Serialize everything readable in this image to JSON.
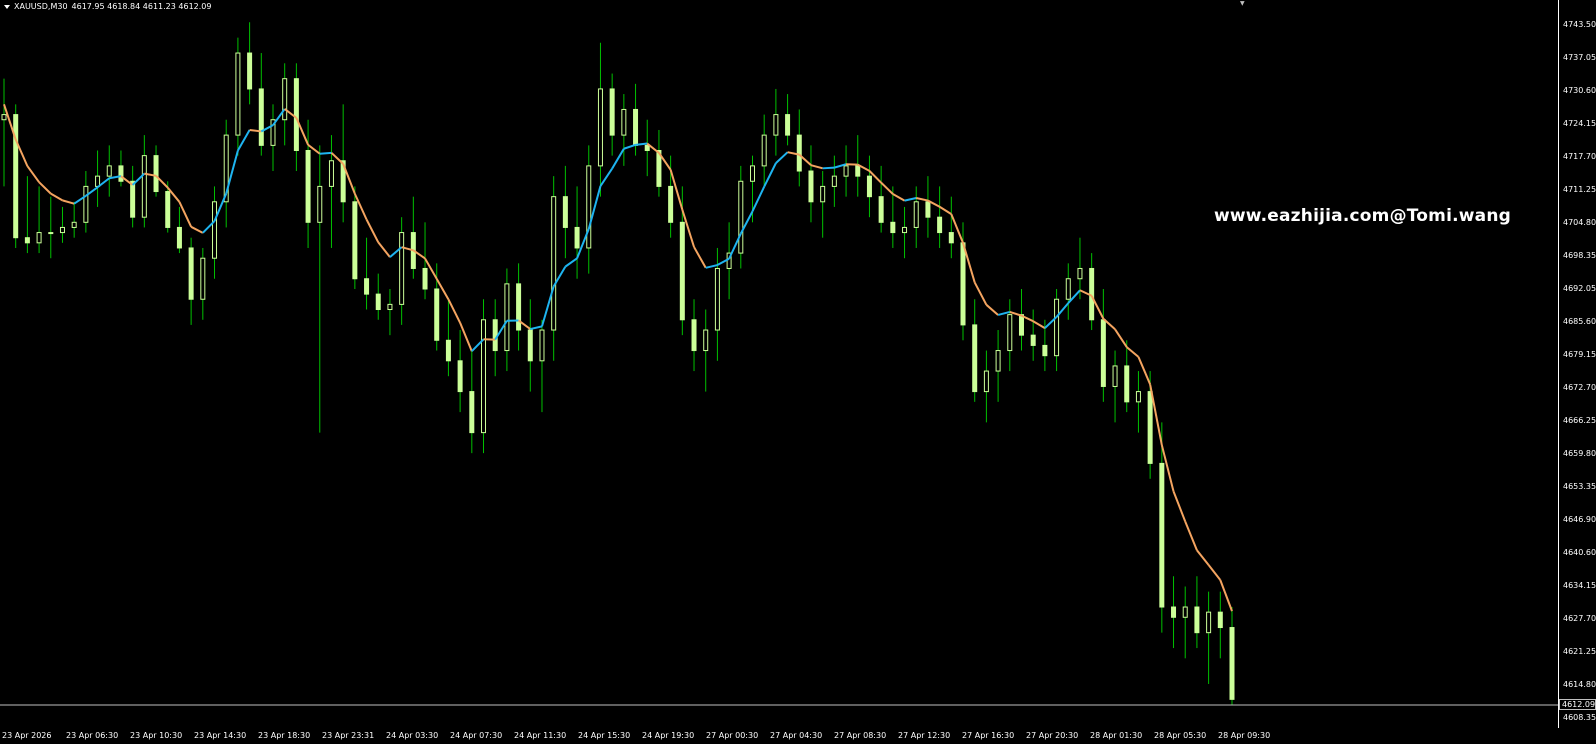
{
  "header": {
    "symbol": "XAUUSD,M30",
    "ohlc": "4617.95 4618.84 4611.23 4612.09"
  },
  "watermark": "www.eazhijia.com@Tomi.wang",
  "current_price": "4612.09",
  "colors": {
    "background": "#000000",
    "axis": "#ffffff",
    "candle_body": "#ccff99",
    "candle_wick": "#00c000",
    "line_up": "#1eb4f0",
    "line_down": "#f4a460",
    "price_line": "#c0c0c0"
  },
  "chart_data": {
    "type": "candlestick",
    "price_ticks": [
      "4743.50",
      "4737.05",
      "4730.60",
      "4724.15",
      "4717.70",
      "4711.25",
      "4704.80",
      "4698.35",
      "4692.05",
      "4685.60",
      "4679.15",
      "4672.70",
      "4666.25",
      "4659.80",
      "4653.35",
      "4646.90",
      "4640.60",
      "4634.15",
      "4627.70",
      "4621.25",
      "4614.80",
      "4608.35"
    ],
    "time_ticks": [
      "23 Apr 2026",
      "23 Apr 06:30",
      "23 Apr 10:30",
      "23 Apr 14:30",
      "23 Apr 18:30",
      "23 Apr 23:31",
      "24 Apr 03:30",
      "24 Apr 07:30",
      "24 Apr 11:30",
      "24 Apr 15:30",
      "24 Apr 19:30",
      "27 Apr 00:30",
      "27 Apr 04:30",
      "27 Apr 08:30",
      "27 Apr 12:30",
      "27 Apr 16:30",
      "27 Apr 20:30",
      "28 Apr 01:30",
      "28 Apr 05:30",
      "28 Apr 09:30"
    ],
    "ylim": [
      4607.0,
      4746.0
    ],
    "candles": [
      [
        4725,
        4733,
        4712,
        4726
      ],
      [
        4726,
        4728,
        4700,
        4702
      ],
      [
        4702,
        4714,
        4699,
        4701
      ],
      [
        4701,
        4712,
        4699,
        4703
      ],
      [
        4703,
        4710,
        4698,
        4703
      ],
      [
        4703,
        4708,
        4701,
        4704
      ],
      [
        4704,
        4709,
        4702,
        4705
      ],
      [
        4705,
        4715,
        4703,
        4712
      ],
      [
        4712,
        4719,
        4708,
        4714
      ],
      [
        4714,
        4720,
        4710,
        4716
      ],
      [
        4716,
        4719,
        4712,
        4713
      ],
      [
        4713,
        4716,
        4704,
        4706
      ],
      [
        4706,
        4722,
        4704,
        4718
      ],
      [
        4718,
        4720,
        4710,
        4711
      ],
      [
        4711,
        4713,
        4703,
        4704
      ],
      [
        4704,
        4708,
        4699,
        4700
      ],
      [
        4700,
        4702,
        4685,
        4690
      ],
      [
        4690,
        4700,
        4686,
        4698
      ],
      [
        4698,
        4712,
        4694,
        4709
      ],
      [
        4709,
        4725,
        4704,
        4722
      ],
      [
        4722,
        4741,
        4718,
        4738
      ],
      [
        4738,
        4744,
        4728,
        4731
      ],
      [
        4731,
        4738,
        4718,
        4720
      ],
      [
        4720,
        4728,
        4715,
        4725
      ],
      [
        4725,
        4736,
        4720,
        4733
      ],
      [
        4733,
        4736,
        4715,
        4719
      ],
      [
        4719,
        4725,
        4700,
        4705
      ],
      [
        4705,
        4720,
        4664,
        4712
      ],
      [
        4712,
        4722,
        4700,
        4717
      ],
      [
        4717,
        4728,
        4705,
        4709
      ],
      [
        4709,
        4712,
        4692,
        4694
      ],
      [
        4694,
        4702,
        4688,
        4691
      ],
      [
        4691,
        4695,
        4686,
        4688
      ],
      [
        4688,
        4692,
        4683,
        4689
      ],
      [
        4689,
        4706,
        4685,
        4703
      ],
      [
        4703,
        4710,
        4694,
        4696
      ],
      [
        4696,
        4705,
        4690,
        4692
      ],
      [
        4692,
        4697,
        4680,
        4682
      ],
      [
        4682,
        4690,
        4675,
        4678
      ],
      [
        4678,
        4684,
        4668,
        4672
      ],
      [
        4672,
        4680,
        4660,
        4664
      ],
      [
        4664,
        4690,
        4660,
        4686
      ],
      [
        4686,
        4690,
        4675,
        4680
      ],
      [
        4680,
        4696,
        4676,
        4693
      ],
      [
        4693,
        4697,
        4680,
        4684
      ],
      [
        4684,
        4690,
        4672,
        4678
      ],
      [
        4678,
        4686,
        4668,
        4684
      ],
      [
        4684,
        4714,
        4678,
        4710
      ],
      [
        4710,
        4716,
        4698,
        4704
      ],
      [
        4704,
        4712,
        4694,
        4700
      ],
      [
        4700,
        4720,
        4695,
        4716
      ],
      [
        4716,
        4740,
        4710,
        4731
      ],
      [
        4731,
        4734,
        4718,
        4722
      ],
      [
        4722,
        4730,
        4716,
        4727
      ],
      [
        4727,
        4732,
        4718,
        4720
      ],
      [
        4720,
        4725,
        4714,
        4719
      ],
      [
        4719,
        4723,
        4710,
        4712
      ],
      [
        4712,
        4718,
        4702,
        4705
      ],
      [
        4705,
        4712,
        4683,
        4686
      ],
      [
        4686,
        4690,
        4676,
        4680
      ],
      [
        4680,
        4688,
        4672,
        4684
      ],
      [
        4684,
        4700,
        4678,
        4696
      ],
      [
        4696,
        4705,
        4690,
        4699
      ],
      [
        4699,
        4716,
        4696,
        4713
      ],
      [
        4713,
        4718,
        4705,
        4716
      ],
      [
        4716,
        4726,
        4712,
        4722
      ],
      [
        4722,
        4731,
        4718,
        4726
      ],
      [
        4726,
        4730,
        4720,
        4722
      ],
      [
        4722,
        4727,
        4712,
        4715
      ],
      [
        4715,
        4720,
        4705,
        4709
      ],
      [
        4709,
        4715,
        4702,
        4712
      ],
      [
        4712,
        4718,
        4708,
        4714
      ],
      [
        4714,
        4720,
        4710,
        4716
      ],
      [
        4716,
        4722,
        4710,
        4714
      ],
      [
        4714,
        4718,
        4706,
        4710
      ],
      [
        4710,
        4716,
        4703,
        4705
      ],
      [
        4705,
        4712,
        4700,
        4703
      ],
      [
        4703,
        4708,
        4698,
        4704
      ],
      [
        4704,
        4712,
        4700,
        4709
      ],
      [
        4709,
        4714,
        4702,
        4706
      ],
      [
        4706,
        4712,
        4700,
        4703
      ],
      [
        4703,
        4710,
        4698,
        4701
      ],
      [
        4701,
        4705,
        4682,
        4685
      ],
      [
        4685,
        4690,
        4670,
        4672
      ],
      [
        4672,
        4680,
        4666,
        4676
      ],
      [
        4676,
        4684,
        4670,
        4680
      ],
      [
        4680,
        4690,
        4676,
        4687
      ],
      [
        4687,
        4692,
        4680,
        4683
      ],
      [
        4683,
        4688,
        4678,
        4681
      ],
      [
        4681,
        4686,
        4676,
        4679
      ],
      [
        4679,
        4692,
        4676,
        4690
      ],
      [
        4690,
        4697,
        4686,
        4694
      ],
      [
        4694,
        4702,
        4690,
        4696
      ],
      [
        4696,
        4699,
        4684,
        4686
      ],
      [
        4686,
        4692,
        4670,
        4673
      ],
      [
        4673,
        4680,
        4666,
        4677
      ],
      [
        4677,
        4682,
        4668,
        4670
      ],
      [
        4670,
        4676,
        4664,
        4672
      ],
      [
        4672,
        4676,
        4655,
        4658
      ],
      [
        4658,
        4666,
        4625,
        4630
      ],
      [
        4630,
        4636,
        4622,
        4628
      ],
      [
        4628,
        4634,
        4620,
        4630
      ],
      [
        4630,
        4636,
        4622,
        4625
      ],
      [
        4625,
        4633,
        4615,
        4629
      ],
      [
        4629,
        4633,
        4620,
        4626
      ],
      [
        4626,
        4630,
        4611,
        4612
      ]
    ],
    "bar_spacing": 6.0,
    "bar_start": 3
  }
}
